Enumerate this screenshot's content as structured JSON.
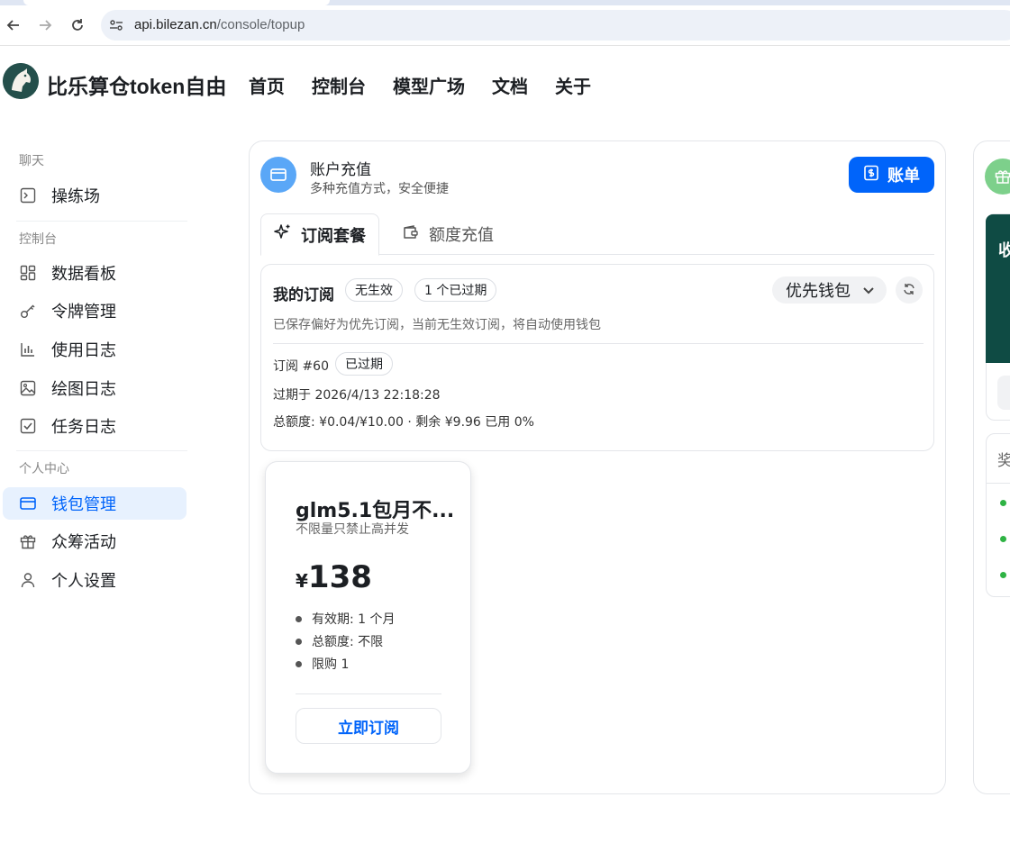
{
  "browser": {
    "url_host": "api.bilezan.cn",
    "url_path": "/console/topup"
  },
  "header": {
    "brand": "比乐算仓token自由",
    "nav": [
      "首页",
      "控制台",
      "模型广场",
      "文档",
      "关于"
    ]
  },
  "sidebar": {
    "groups": [
      {
        "title": "聊天",
        "items": [
          {
            "label": "操练场",
            "icon": "terminal-icon"
          }
        ]
      },
      {
        "title": "控制台",
        "items": [
          {
            "label": "数据看板",
            "icon": "dashboard-icon"
          },
          {
            "label": "令牌管理",
            "icon": "key-icon"
          },
          {
            "label": "使用日志",
            "icon": "bar-chart-icon"
          },
          {
            "label": "绘图日志",
            "icon": "image-icon"
          },
          {
            "label": "任务日志",
            "icon": "checkbox-icon"
          }
        ]
      },
      {
        "title": "个人中心",
        "items": [
          {
            "label": "钱包管理",
            "icon": "wallet-icon",
            "active": true
          },
          {
            "label": "众筹活动",
            "icon": "gift-icon"
          },
          {
            "label": "个人设置",
            "icon": "user-icon"
          }
        ]
      }
    ]
  },
  "topup": {
    "title": "账户充值",
    "subtitle": "多种充值方式，安全便捷",
    "bill_button": "账单",
    "tabs": [
      {
        "label": "订阅套餐",
        "active": true
      },
      {
        "label": "额度充值",
        "active": false
      }
    ],
    "subscription": {
      "title": "我的订阅",
      "badge_active": "无生效",
      "badge_expired": "1 个已过期",
      "preference": "优先钱包",
      "description": "已保存偏好为优先订阅，当前无生效订阅，将自动使用钱包",
      "order_label": "订阅 #60",
      "order_status": "已过期",
      "expires": "过期于 2026/4/13 22:18:28",
      "quota": "总额度: ¥0.04/¥10.00 · 剩余 ¥9.96   已用 0%"
    },
    "plan": {
      "name": "glm5.1包月不...",
      "desc": "不限量只禁止高并发",
      "currency": "¥",
      "price": "138",
      "features": [
        "有效期: 1 个月",
        "总额度: 不限",
        "限购 1"
      ],
      "button": "立即订阅"
    }
  },
  "right_panel": {
    "banner_char": "收",
    "box_title": "奖"
  },
  "colors": {
    "primary": "#0064fa",
    "active_bg": "#e7f1fe",
    "topup_icon_bg": "#5aa7f7",
    "gift_icon_bg": "#7dd08b",
    "banner_bg": "#0f4b44",
    "status_green": "#2fb344"
  }
}
